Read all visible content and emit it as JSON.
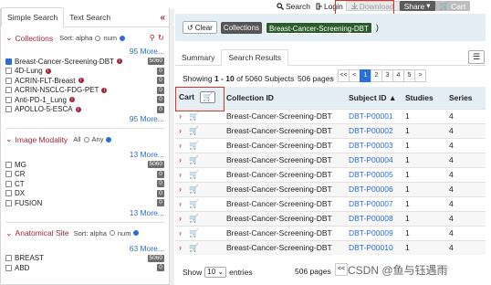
{
  "top": {
    "search": "Search",
    "login": "Login",
    "download": "Download",
    "share": "Share",
    "cart": "Cart"
  },
  "left": {
    "tab_simple": "Simple Search",
    "tab_text": "Text Search",
    "collections": {
      "title": "Collections",
      "sort_label": "Sort: alpha",
      "num_label": "num",
      "more_top": "95 More...",
      "more_bottom": "95 More...",
      "items": [
        {
          "label": "Breast-Cancer-Screening-DBT",
          "count": "5060",
          "checked": true
        },
        {
          "label": "4D-Lung",
          "count": "0",
          "checked": false
        },
        {
          "label": "ACRIN-FLT-Breast",
          "count": "0",
          "checked": false
        },
        {
          "label": "ACRIN-NSCLC-FDG-PET",
          "count": "0",
          "checked": false
        },
        {
          "label": "Anti-PD-1_Lung",
          "count": "0",
          "checked": false
        },
        {
          "label": "APOLLO-5-ESCA",
          "count": "0",
          "checked": false
        }
      ]
    },
    "modality": {
      "title": "Image Modality",
      "all": "All",
      "any": "Any",
      "more_top": "13 More...",
      "more_bottom": "13 More...",
      "items": [
        {
          "label": "MG",
          "count": "5060"
        },
        {
          "label": "CR",
          "count": "0"
        },
        {
          "label": "CT",
          "count": "0"
        },
        {
          "label": "DX",
          "count": "0"
        },
        {
          "label": "FUSION",
          "count": "0"
        }
      ]
    },
    "site": {
      "title": "Anatomical Site",
      "sort_label": "Sort: alpha",
      "num_label": "num",
      "more": "63 More...",
      "items": [
        {
          "label": "BREAST",
          "count": "5060"
        },
        {
          "label": "ABD",
          "count": "0"
        }
      ]
    }
  },
  "filter": {
    "clear": "Clear",
    "collections_pill": "Collections",
    "value_pill": "Breast-Cancer-Screening-DBT",
    "close_paren": ")"
  },
  "rtabs": {
    "summary": "Summary",
    "results": "Search Results"
  },
  "showing": {
    "prefix": "Showing ",
    "range": "1 - 10",
    "mid": " of 5060 Subjects",
    "pages": "506 pages"
  },
  "pager": [
    "<<",
    "<",
    "1",
    "2",
    "3",
    "4",
    "5",
    ">"
  ],
  "table": {
    "headers": {
      "cart": "Cart",
      "collection": "Collection ID",
      "subject": "Subject ID",
      "studies": "Studies",
      "series": "Series"
    },
    "rows": [
      {
        "collection": "Breast-Cancer-Screening-DBT",
        "subject": "DBT-P00001",
        "studies": "1",
        "series": "4"
      },
      {
        "collection": "Breast-Cancer-Screening-DBT",
        "subject": "DBT-P00002",
        "studies": "1",
        "series": "4"
      },
      {
        "collection": "Breast-Cancer-Screening-DBT",
        "subject": "DBT-P00003",
        "studies": "1",
        "series": "4"
      },
      {
        "collection": "Breast-Cancer-Screening-DBT",
        "subject": "DBT-P00004",
        "studies": "1",
        "series": "4"
      },
      {
        "collection": "Breast-Cancer-Screening-DBT",
        "subject": "DBT-P00005",
        "studies": "1",
        "series": "4"
      },
      {
        "collection": "Breast-Cancer-Screening-DBT",
        "subject": "DBT-P00006",
        "studies": "1",
        "series": "4"
      },
      {
        "collection": "Breast-Cancer-Screening-DBT",
        "subject": "DBT-P00007",
        "studies": "1",
        "series": "4"
      },
      {
        "collection": "Breast-Cancer-Screening-DBT",
        "subject": "DBT-P00008",
        "studies": "1",
        "series": "4"
      },
      {
        "collection": "Breast-Cancer-Screening-DBT",
        "subject": "DBT-P00009",
        "studies": "1",
        "series": "4"
      },
      {
        "collection": "Breast-Cancer-Screening-DBT",
        "subject": "DBT-P00010",
        "studies": "1",
        "series": "4"
      }
    ]
  },
  "footer": {
    "show": "Show",
    "entries_value": "10",
    "entries": "entries",
    "pages": "506 pages",
    "first": "<<"
  },
  "watermark": "CSDN @鱼与钰遇雨"
}
